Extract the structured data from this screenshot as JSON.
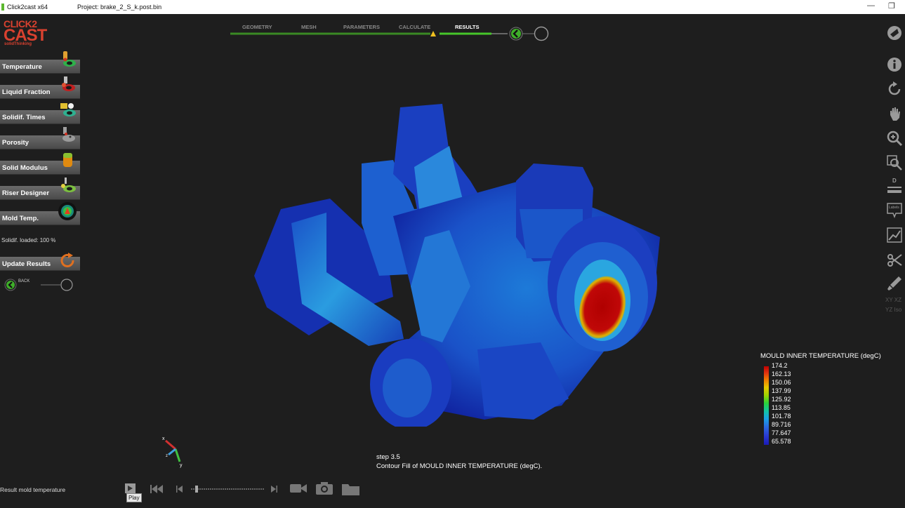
{
  "titlebar": {
    "app": "Click2cast x64",
    "project": "Project: brake_2_S_k.post.bin",
    "minimize": "—",
    "maximize": "❐"
  },
  "logo": {
    "line1": "CLICK2",
    "line2": "CAST",
    "line3": "solidThinking"
  },
  "menu": [
    {
      "label": "Temperature"
    },
    {
      "label": "Liquid Fraction"
    },
    {
      "label": "Solidif. Times"
    },
    {
      "label": "Porosity"
    },
    {
      "label": "Solid Modulus"
    },
    {
      "label": "Riser Designer"
    },
    {
      "label": "Mold Temp."
    }
  ],
  "status": {
    "solidif_loaded": "Solidif. loaded: 100 %"
  },
  "update_results": {
    "label": "Update Results"
  },
  "back": {
    "label": "BACK"
  },
  "progress": {
    "steps": [
      "GEOMETRY",
      "MESH",
      "PARAMETERS",
      "CALCULATE",
      "RESULTS"
    ],
    "active": "RESULTS"
  },
  "legend": {
    "title": "MOULD INNER TEMPERATURE (degC)",
    "values": [
      "174.2",
      "162.13",
      "150.06",
      "137.99",
      "125.92",
      "113.85",
      "101.78",
      "89.716",
      "77.647",
      "65.578"
    ]
  },
  "caption": {
    "step": "step 3.5",
    "text": "Contour Fill of MOULD INNER TEMPERATURE (degC)."
  },
  "bottom": {
    "result_label": "Result mold temperature",
    "play_tooltip": "Play"
  },
  "axes": {
    "x": "x",
    "y": "y",
    "z": "z"
  },
  "right_tools": {
    "xy_label": "XY",
    "xz_label": "XZ",
    "yz_label": "YZ",
    "iso_label": "Iso",
    "d_label": "D",
    "labels_label": "Labels"
  },
  "colors": {
    "accent_green": "#3fae2a",
    "logo_red": "#d8412f",
    "warning_yellow": "#f0c020"
  }
}
